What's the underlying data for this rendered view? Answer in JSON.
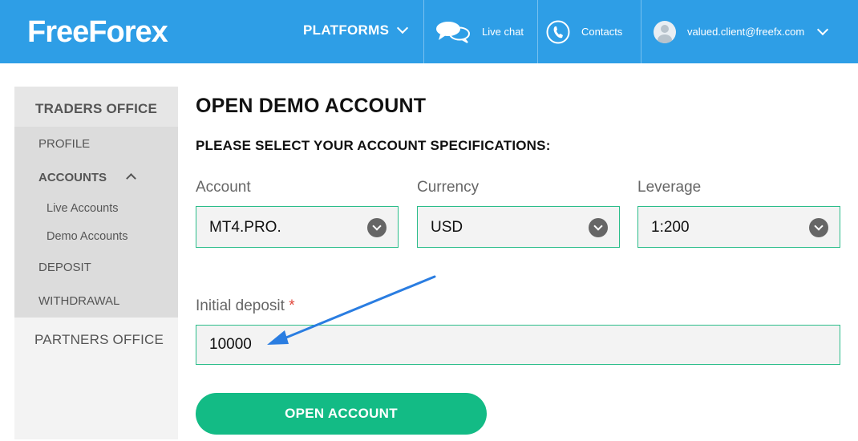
{
  "header": {
    "logo": "FreeForex",
    "platforms_label": "PLATFORMS",
    "live_chat_label": "Live chat",
    "contacts_label": "Contacts",
    "user_email": "valued.client@freefx.com",
    "background_color": "#2e9ee6"
  },
  "sidebar": {
    "traders_office": "TRADERS OFFICE",
    "items": [
      {
        "label": "PROFILE"
      },
      {
        "label": "ACCOUNTS",
        "expanded": true
      },
      {
        "label": "DEPOSIT"
      },
      {
        "label": "WITHDRAWAL"
      }
    ],
    "accounts_children": [
      {
        "label": "Live Accounts"
      },
      {
        "label": "Demo Accounts"
      }
    ],
    "partners_office": "PARTNERS OFFICE"
  },
  "main": {
    "title": "OPEN DEMO ACCOUNT",
    "spec_title": "PLEASE SELECT YOUR ACCOUNT SPECIFICATIONS:",
    "account": {
      "label": "Account",
      "value": "MT4.PRO."
    },
    "currency": {
      "label": "Currency",
      "value": "USD"
    },
    "leverage": {
      "label": "Leverage",
      "value": "1:200"
    },
    "initial_deposit": {
      "label": "Initial deposit",
      "required_marker": "*",
      "value": "10000"
    },
    "open_button": "OPEN ACCOUNT"
  },
  "colors": {
    "accent_green": "#13bb85",
    "field_border": "#2bbd8a",
    "required_red": "#e0453a",
    "annotation_arrow": "#2a7de1"
  }
}
